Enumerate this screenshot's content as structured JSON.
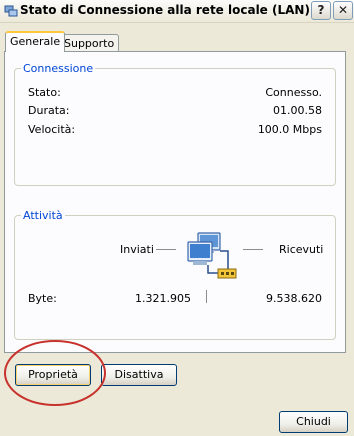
{
  "window": {
    "title": "Stato di Connessione alla rete locale (LAN)",
    "help_label": "?",
    "close_label": "✕"
  },
  "tabs": [
    {
      "label": "Generale",
      "active": true
    },
    {
      "label": "Supporto",
      "active": false
    }
  ],
  "connection": {
    "group_label": "Connessione",
    "rows": [
      {
        "label": "Stato:",
        "value": "Connesso."
      },
      {
        "label": "Durata:",
        "value": "01.00.58"
      },
      {
        "label": "Velocità:",
        "value": "100.0 Mbps"
      }
    ]
  },
  "activity": {
    "group_label": "Attività",
    "sent_label": "Inviati",
    "received_label": "Ricevuti",
    "bytes_label": "Byte:",
    "bytes_sent": "1.321.905",
    "bytes_received": "9.538.620",
    "icon": "network-computers-icon"
  },
  "buttons": {
    "properties": "Proprietà",
    "disable": "Disattiva",
    "close": "Chiudi"
  },
  "colors": {
    "window_bg": "#ece9d8",
    "group_title": "#0046d5",
    "annotation": "#c8322d"
  }
}
